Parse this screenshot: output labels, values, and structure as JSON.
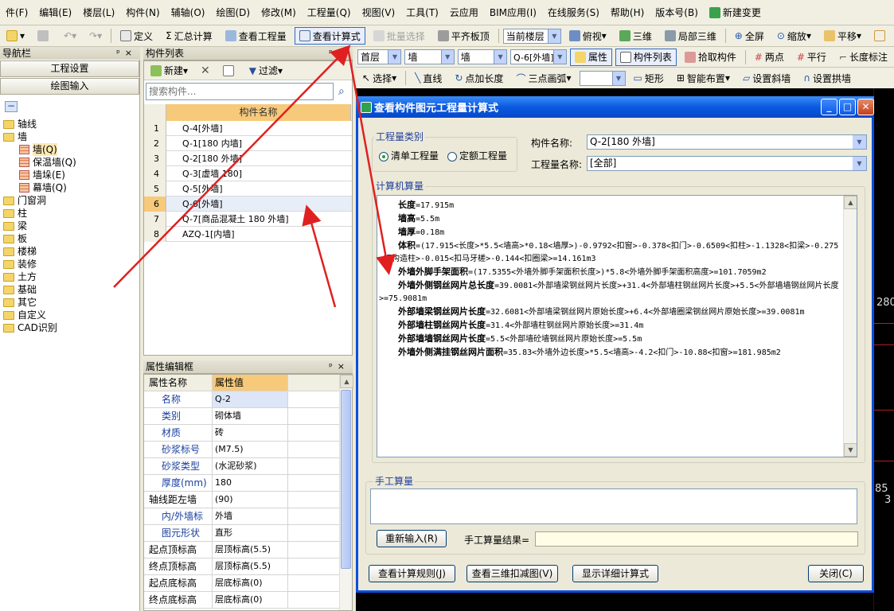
{
  "menubar": [
    "件(F)",
    "编辑(E)",
    "楼层(L)",
    "构件(N)",
    "辅轴(O)",
    "绘图(D)",
    "修改(M)",
    "工程量(Q)",
    "视图(V)",
    "工具(T)",
    "云应用",
    "BIM应用(I)",
    "在线服务(S)",
    "帮助(H)",
    "版本号(B)",
    "新建变更"
  ],
  "toolbar1": {
    "define": "定义",
    "summary": "汇总计算",
    "view_quantity": "查看工程量",
    "view_formula": "查看计算式",
    "batch_select": "批量选择",
    "flush_slab": "平齐板顶",
    "current_floor": "当前楼层",
    "top_view": "俯视",
    "three_d": "三维",
    "local_3d": "局部三维",
    "fullscreen": "全屏",
    "zoom": "缩放",
    "pan": "平移"
  },
  "toolbar2": {
    "floor": "首层",
    "category": "墙",
    "type": "墙",
    "component": "Q-6[外墙]",
    "attributes": "属性",
    "component_list": "构件列表",
    "pick": "拾取构件",
    "two_points": "两点",
    "parallel": "平行",
    "length_label": "长度标注"
  },
  "toolbar3": {
    "select": "选择",
    "line": "直线",
    "point_extend": "点加长度",
    "arc": "三点画弧",
    "rect": "矩形",
    "smart_layout": "智能布置",
    "slope_wall": "设置斜墙",
    "arch_wall": "设置拱墙"
  },
  "nav": {
    "title": "导航栏",
    "project_settings": "工程设置",
    "drawing_input": "绘图输入",
    "tree": [
      {
        "label": "轴线",
        "level": 0
      },
      {
        "label": "墙",
        "level": 0
      },
      {
        "label": "墙(Q)",
        "level": 1
      },
      {
        "label": "保温墙(Q)",
        "level": 1
      },
      {
        "label": "墙垛(E)",
        "level": 1
      },
      {
        "label": "幕墙(Q)",
        "level": 1
      },
      {
        "label": "门窗洞",
        "level": 0
      },
      {
        "label": "柱",
        "level": 0
      },
      {
        "label": "梁",
        "level": 0
      },
      {
        "label": "板",
        "level": 0
      },
      {
        "label": "楼梯",
        "level": 0
      },
      {
        "label": "装修",
        "level": 0
      },
      {
        "label": "土方",
        "level": 0
      },
      {
        "label": "基础",
        "level": 0
      },
      {
        "label": "其它",
        "level": 0
      },
      {
        "label": "自定义",
        "level": 0
      },
      {
        "label": "CAD识别",
        "level": 0
      }
    ]
  },
  "component_list": {
    "title": "构件列表",
    "new_label": "新建",
    "filter_label": "过滤",
    "search_placeholder": "搜索构件...",
    "column_header": "构件名称",
    "rows": [
      {
        "num": "1",
        "name": "Q-4[外墙]"
      },
      {
        "num": "2",
        "name": "Q-1[180 内墙]"
      },
      {
        "num": "3",
        "name": "Q-2[180 外墙]"
      },
      {
        "num": "4",
        "name": "Q-3[虚墙 180]"
      },
      {
        "num": "5",
        "name": "Q-5[外墙]"
      },
      {
        "num": "6",
        "name": "Q-6[外墙]"
      },
      {
        "num": "7",
        "name": "Q-7[商品混凝土 180 外墙]"
      },
      {
        "num": "8",
        "name": "AZQ-1[内墙]"
      }
    ]
  },
  "properties": {
    "title": "属性编辑框",
    "col_name": "属性名称",
    "col_value": "属性值",
    "rows": [
      {
        "name": "名称",
        "value": "Q-2",
        "blue": true
      },
      {
        "name": "类别",
        "value": "砌体墙",
        "blue": true
      },
      {
        "name": "材质",
        "value": "砖",
        "blue": true
      },
      {
        "name": "砂浆标号",
        "value": "(M7.5)",
        "blue": true
      },
      {
        "name": "砂浆类型",
        "value": "(水泥砂浆)",
        "blue": true
      },
      {
        "name": "厚度(mm)",
        "value": "180",
        "blue": true
      },
      {
        "name": "轴线距左墙",
        "value": "(90)",
        "blue": false
      },
      {
        "name": "内/外墙标",
        "value": "外墙",
        "blue": true
      },
      {
        "name": "图元形状",
        "value": "直形",
        "blue": true
      },
      {
        "name": "起点顶标高",
        "value": "层顶标高(5.5)",
        "blue": false
      },
      {
        "name": "终点顶标高",
        "value": "层顶标高(5.5)",
        "blue": false
      },
      {
        "name": "起点底标高",
        "value": "层底标高(0)",
        "blue": false
      },
      {
        "name": "终点底标高",
        "value": "层底标高(0)",
        "blue": false
      }
    ]
  },
  "dialog": {
    "title": "查看构件图元工程量计算式",
    "category_group": "工程量类别",
    "radio_list": "清单工程量",
    "radio_quota": "定额工程量",
    "component_name_label": "构件名称:",
    "component_name_value": "Q-2[180 外墙]",
    "quantity_name_label": "工程量名称:",
    "quantity_name_value": "[全部]",
    "computer_group": "计算机算量",
    "lines": [
      {
        "k": "长度",
        "v": "=17.915m"
      },
      {
        "k": "墙高",
        "v": "=5.5m"
      },
      {
        "k": "墙厚",
        "v": "=0.18m"
      },
      {
        "k": "体积",
        "v": "=(17.915<长度>*5.5<墙高>*0.18<墙厚>)-0.9792<扣窗>-0.378<扣门>-0.6509<扣柱>-1.1328<扣梁>-0.275<扣构造柱>-0.015<扣马牙槎>-0.144<扣圈梁>=14.161m3"
      },
      {
        "k": "外墙外脚手架面积",
        "v": "=(17.5355<外墙外脚手架面积长度>)*5.8<外墙外脚手架面积高度>=101.7059m2"
      },
      {
        "k": "外墙外侧钢丝网片总长度",
        "v": "=39.0081<外部墙梁钢丝网片长度>+31.4<外部墙柱钢丝网片长度>+5.5<外部墙墙钢丝网片长度>=75.9081m"
      },
      {
        "k": "外部墙梁钢丝网片长度",
        "v": "=32.6081<外部墙梁钢丝网片原始长度>+6.4<外部墙圈梁钢丝网片原始长度>=39.0081m"
      },
      {
        "k": "外部墙柱钢丝网片长度",
        "v": "=31.4<外部墙柱钢丝网片原始长度>=31.4m"
      },
      {
        "k": "外部墙墙钢丝网片长度",
        "v": "=5.5<外部墙砼墙钢丝网片原始长度>=5.5m"
      },
      {
        "k": "外墙外侧满挂钢丝网片面积",
        "v": "=35.83<外墙外边长度>*5.5<墙高>-4.2<扣门>-10.88<扣窗>=181.985m2"
      }
    ],
    "manual_group": "手工算量",
    "reinput": "重新输入(R)",
    "manual_result_label": "手工算量结果=",
    "btn_rules": "查看计算规则(J)",
    "btn_3d": "查看三维扣减图(V)",
    "btn_detail": "显示详细计算式",
    "btn_close": "关闭(C)"
  },
  "canvas": {
    "dim_280": "280",
    "dim_85": "85",
    "dim_3": "3"
  },
  "colors": {
    "title_bar": "#0a5ae0",
    "selection": "#316ac5",
    "header_orange": "#f7c97a",
    "arrow": "#e02020"
  }
}
